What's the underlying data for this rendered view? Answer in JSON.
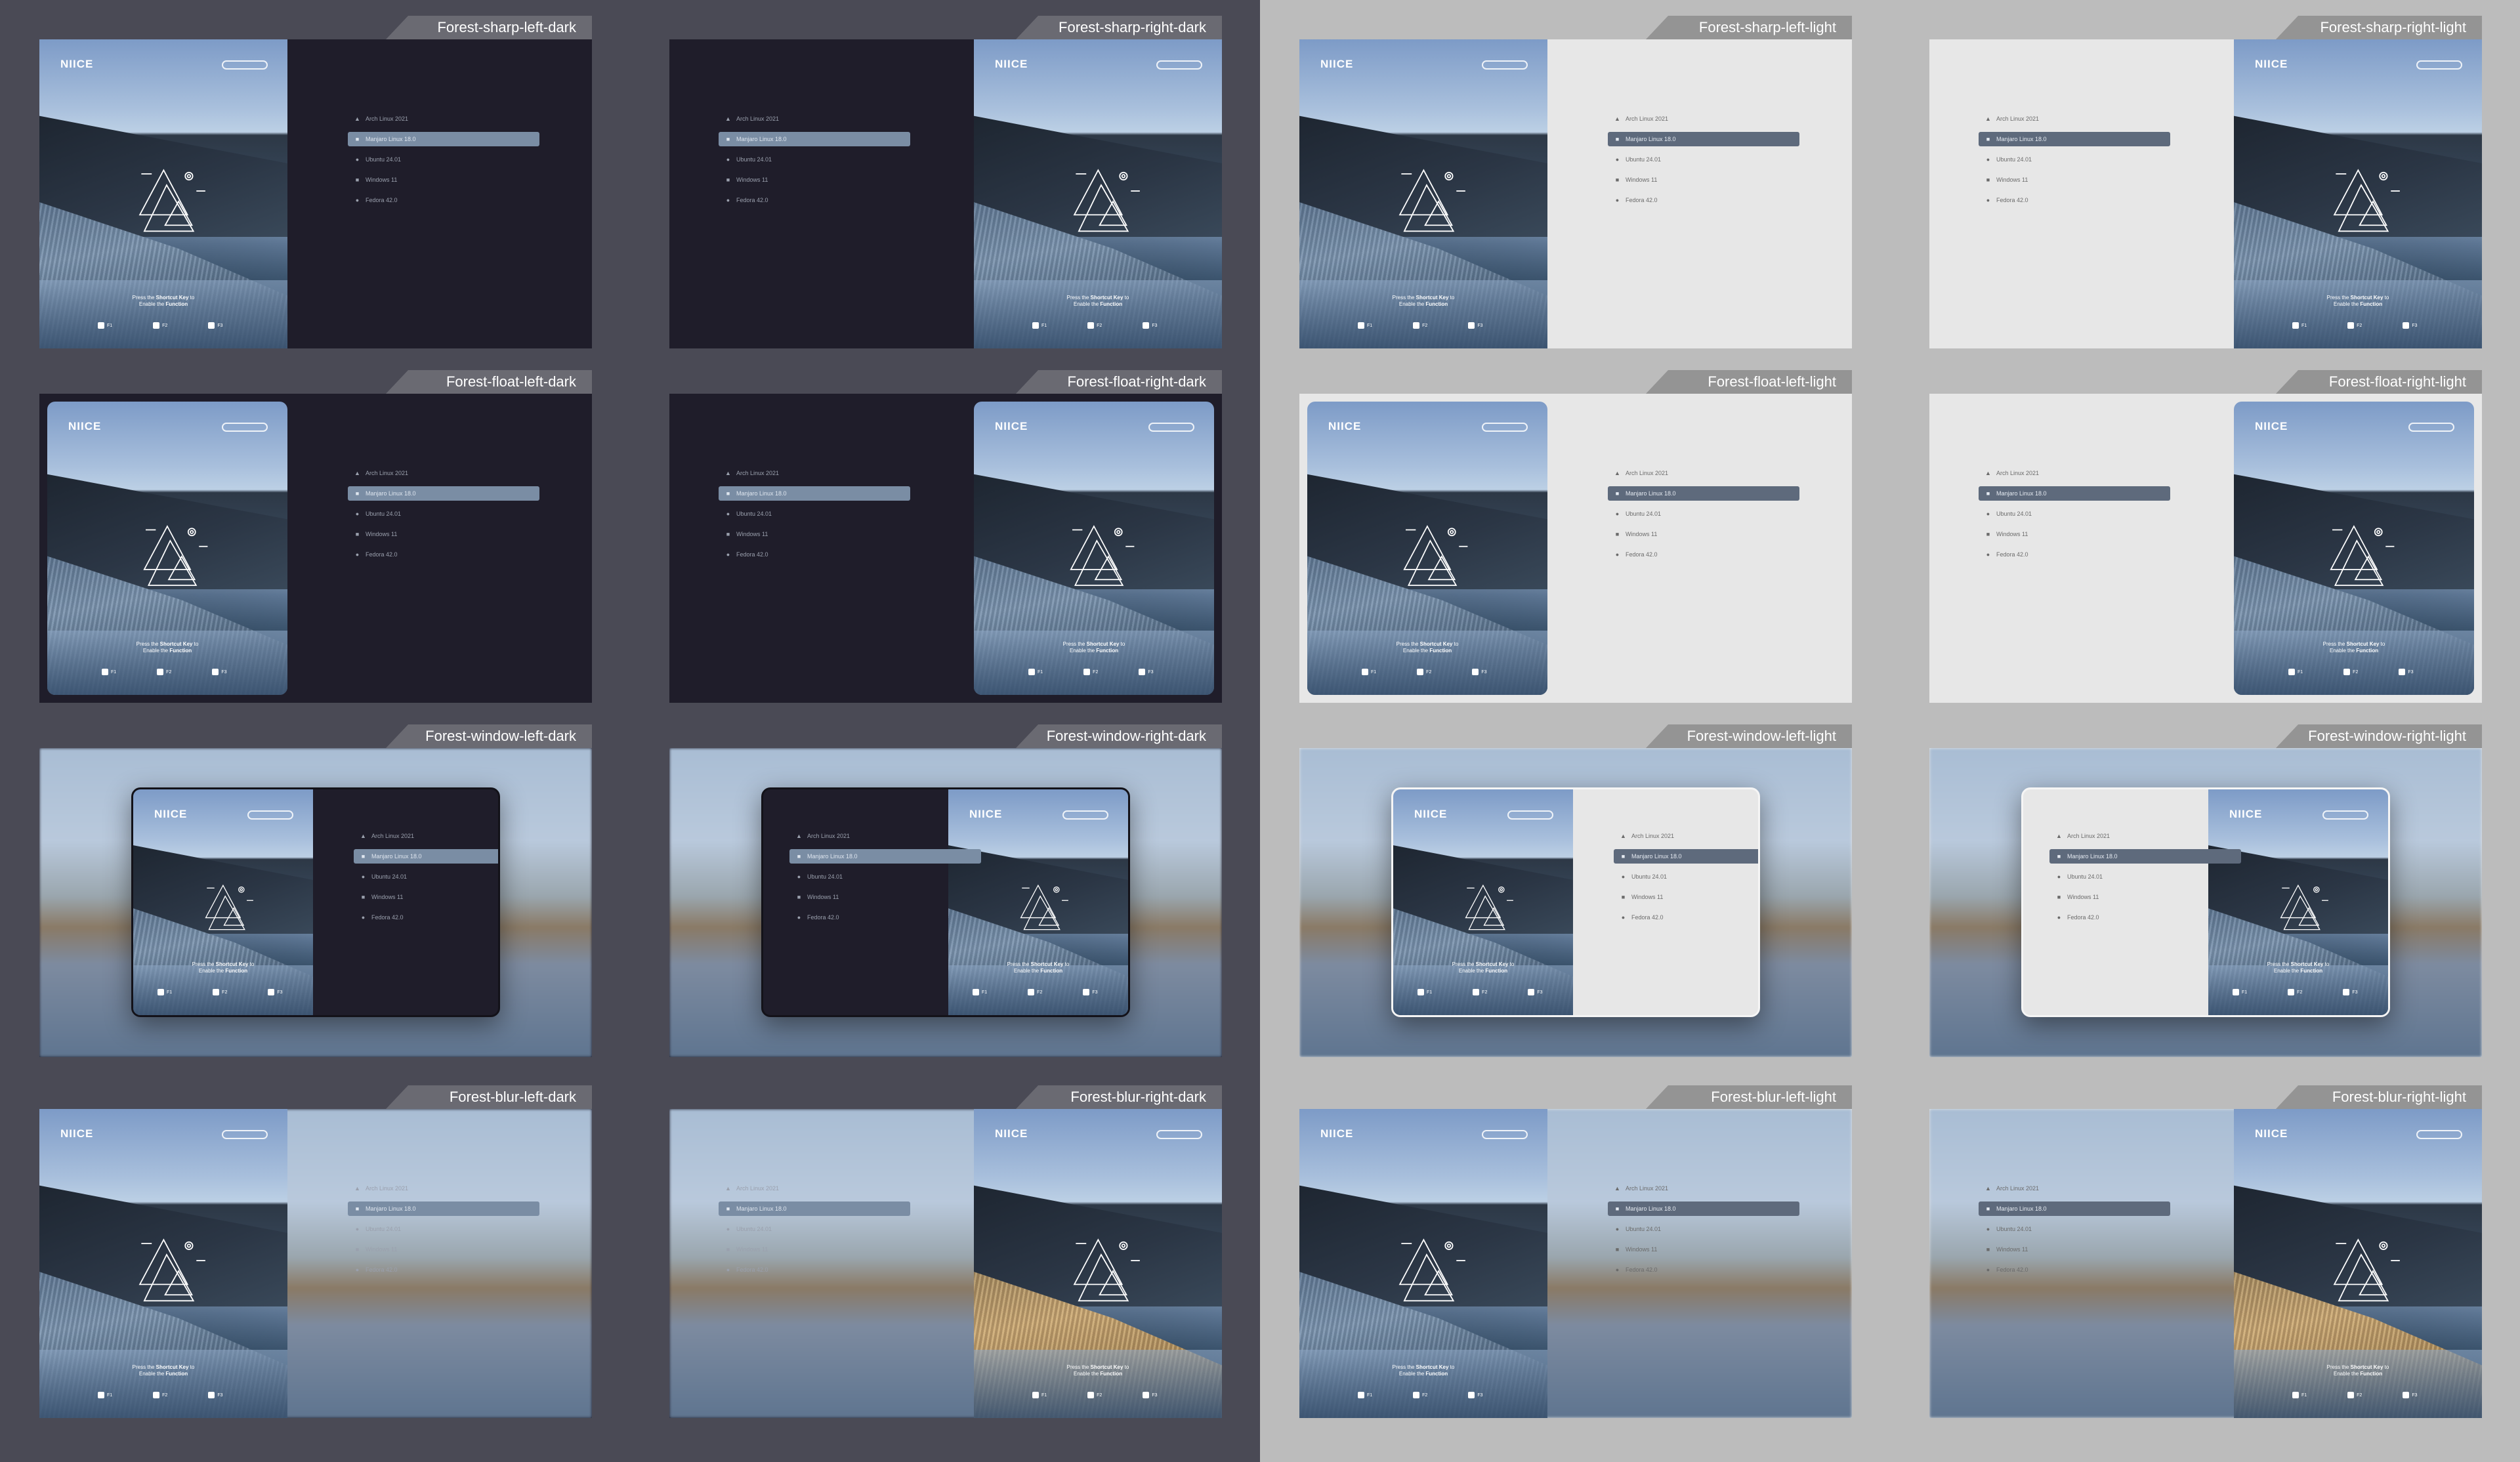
{
  "variants": [
    {
      "label": "Forest-sharp-left-dark"
    },
    {
      "label": "Forest-sharp-right-dark"
    },
    {
      "label": "Forest-sharp-left-light"
    },
    {
      "label": "Forest-sharp-right-light"
    },
    {
      "label": "Forest-float-left-dark"
    },
    {
      "label": "Forest-float-right-dark"
    },
    {
      "label": "Forest-float-left-light"
    },
    {
      "label": "Forest-float-right-light"
    },
    {
      "label": "Forest-window-left-dark"
    },
    {
      "label": "Forest-window-right-dark"
    },
    {
      "label": "Forest-window-left-light"
    },
    {
      "label": "Forest-window-right-light"
    },
    {
      "label": "Forest-blur-left-dark"
    },
    {
      "label": "Forest-blur-right-dark"
    },
    {
      "label": "Forest-blur-left-light"
    },
    {
      "label": "Forest-blur-right-light"
    }
  ],
  "brand": "NIICE",
  "menu_entries": [
    {
      "label": "Arch Linux 2021",
      "icon": "arch-icon",
      "glyph": "▲"
    },
    {
      "label": "Manjaro Linux 18.0",
      "icon": "manjaro-icon",
      "glyph": "■"
    },
    {
      "label": "Ubuntu 24.01",
      "icon": "ubuntu-icon",
      "glyph": "●"
    },
    {
      "label": "Windows 11",
      "icon": "windows-icon",
      "glyph": "■"
    },
    {
      "label": "Fedora 42.0",
      "icon": "fedora-icon",
      "glyph": "●"
    }
  ],
  "hint": {
    "line1_pre": "Press the",
    "line1_key": "Shortcut Key",
    "line1_post": "to",
    "line2_pre": "Enable the",
    "line2_key": "Function"
  },
  "system_buttons": [
    {
      "icon": "power-icon",
      "label": "F1"
    },
    {
      "icon": "restart-icon",
      "label": "F2"
    },
    {
      "icon": "firmware-icon",
      "label": "F3"
    }
  ]
}
